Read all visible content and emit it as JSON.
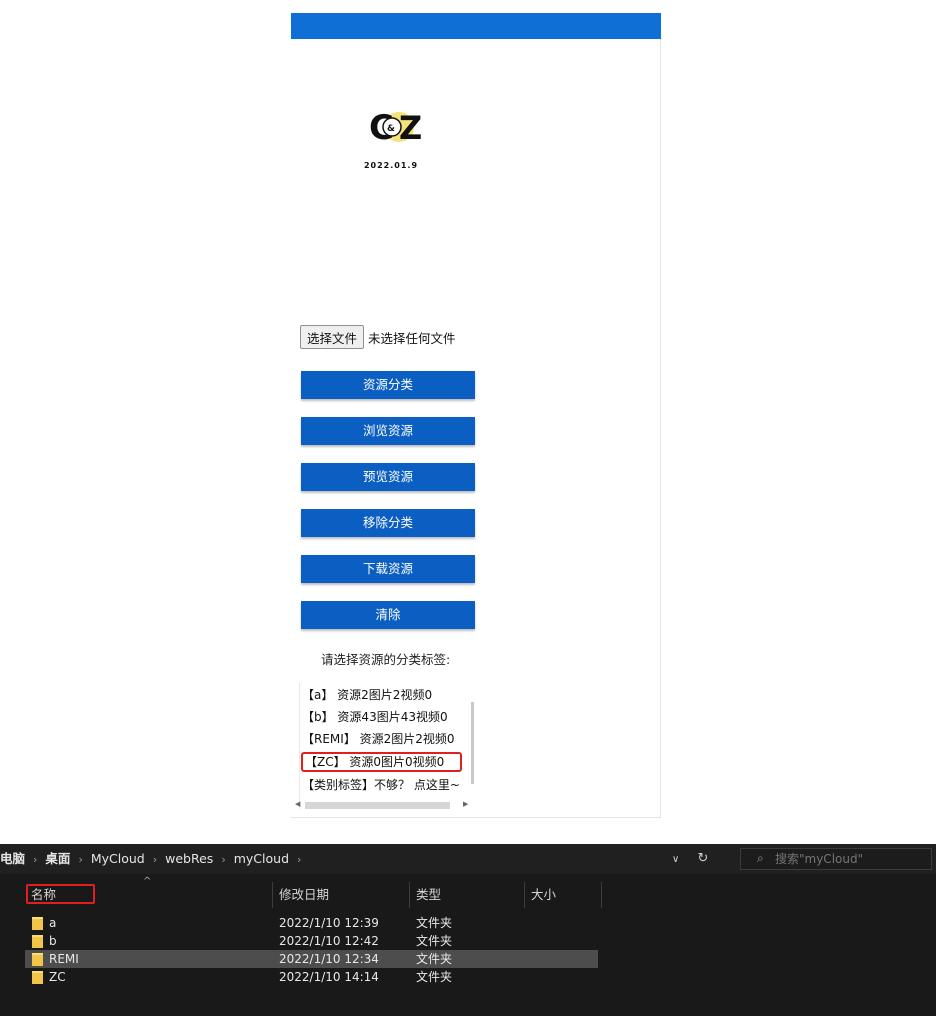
{
  "app": {
    "logo_text": "C&Z",
    "logo_date": "2022.01.9",
    "file_button": "选择文件",
    "file_status": "未选择任何文件",
    "actions": [
      "资源分类",
      "浏览资源",
      "预览资源",
      "移除分类",
      "下载资源",
      "清除"
    ],
    "prompt": "请选择资源的分类标签:",
    "tags": [
      "【a】 资源2图片2视频0",
      "【b】 资源43图片43视频0",
      "【REMI】 资源2图片2视频0",
      "【ZC】 资源0图片0视频0",
      "【类别标签】不够？ 点这里~"
    ],
    "highlight_color": "#e02020",
    "accent_color": "#0c5fc2"
  },
  "explorer": {
    "breadcrumbs": [
      "电脑",
      "桌面",
      "MyCloud",
      "webRes",
      "myCloud"
    ],
    "search_placeholder": "搜索\"myCloud\"",
    "columns": {
      "name": "名称",
      "date": "修改日期",
      "type": "类型",
      "size": "大小"
    },
    "rows": [
      {
        "name": "a",
        "date": "2022/1/10 12:39",
        "type": "文件夹",
        "selected": false
      },
      {
        "name": "b",
        "date": "2022/1/10 12:42",
        "type": "文件夹",
        "selected": false
      },
      {
        "name": "REMI",
        "date": "2022/1/10 12:34",
        "type": "文件夹",
        "selected": true
      },
      {
        "name": "ZC",
        "date": "2022/1/10 14:14",
        "type": "文件夹",
        "selected": false
      }
    ],
    "icons": {
      "dropdown": "chevron-down-icon",
      "refresh": "refresh-icon",
      "search": "search-icon",
      "folder": "folder-icon"
    }
  }
}
